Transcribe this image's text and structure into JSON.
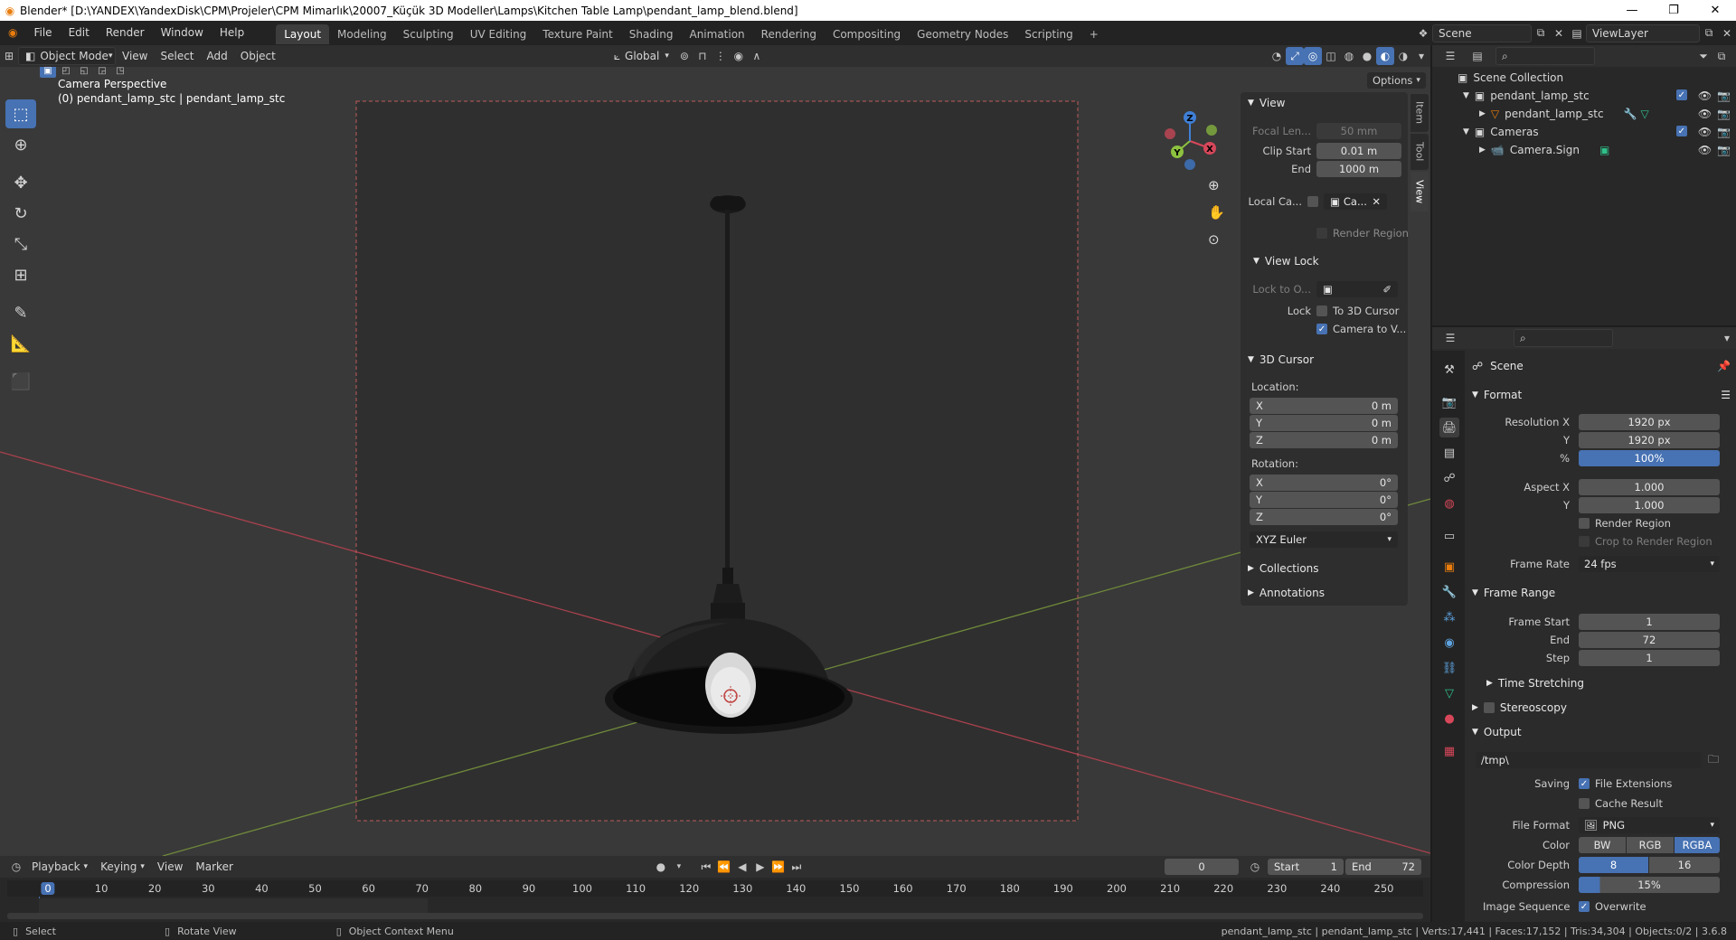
{
  "window": {
    "title": "Blender* [D:\\YANDEX\\YandexDisk\\CPM\\Projeler\\CPM Mimarlık\\20007_Küçük 3D Modeller\\Lamps\\Kitchen Table Lamp\\pendant_lamp_blend.blend]"
  },
  "menu": {
    "file": "File",
    "edit": "Edit",
    "render": "Render",
    "window": "Window",
    "help": "Help"
  },
  "workspaces": [
    "Layout",
    "Modeling",
    "Sculpting",
    "UV Editing",
    "Texture Paint",
    "Shading",
    "Animation",
    "Rendering",
    "Compositing",
    "Geometry Nodes",
    "Scripting"
  ],
  "scene_field": "Scene",
  "viewlayer_field": "ViewLayer",
  "viewport_header": {
    "mode": "Object Mode",
    "view": "View",
    "select": "Select",
    "add": "Add",
    "object": "Object",
    "orientation": "Global",
    "options": "Options"
  },
  "viewport": {
    "overlay_line1": "Camera Perspective",
    "overlay_line2": "(0) pendant_lamp_stc | pendant_lamp_stc",
    "gizmo": {
      "x": "X",
      "y": "Y",
      "z": "Z"
    }
  },
  "npanel": {
    "tabs": [
      "Item",
      "Tool",
      "View"
    ],
    "view_section": "View",
    "focal_label": "Focal Len...",
    "focal_value": "50 mm",
    "clip_start_label": "Clip Start",
    "clip_start_value": "0.01 m",
    "end_label": "End",
    "end_value": "1000 m",
    "local_cam_label": "Local Ca...",
    "local_cam_value": "Ca...",
    "render_region": "Render Region",
    "view_lock": "View Lock",
    "lock_to_label": "Lock to O...",
    "lock_label": "Lock",
    "to_3d_cursor": "To 3D Cursor",
    "camera_to_view": "Camera to V...",
    "cursor_section": "3D Cursor",
    "location_label": "Location:",
    "loc_x": "0 m",
    "loc_y": "0 m",
    "loc_z": "0 m",
    "rotation_label": "Rotation:",
    "rot_x": "0°",
    "rot_y": "0°",
    "rot_z": "0°",
    "axis_x": "X",
    "axis_y": "Y",
    "axis_z": "Z",
    "rotation_mode": "XYZ Euler",
    "collections": "Collections",
    "annotations": "Annotations"
  },
  "outliner": {
    "scene_collection": "Scene Collection",
    "items": [
      {
        "name": "pendant_lamp_stc"
      },
      {
        "name": "pendant_lamp_stc"
      },
      {
        "name": "Cameras"
      },
      {
        "name": "Camera.Sign"
      }
    ]
  },
  "properties": {
    "context": "Scene",
    "format": "Format",
    "res_x_label": "Resolution X",
    "res_x": "1920 px",
    "res_y_label": "Y",
    "res_y": "1920 px",
    "pct_label": "%",
    "pct": "100%",
    "aspect_x_label": "Aspect X",
    "aspect_x": "1.000",
    "aspect_y_label": "Y",
    "aspect_y": "1.000",
    "render_region": "Render Region",
    "crop": "Crop to Render Region",
    "frame_rate_label": "Frame Rate",
    "frame_rate": "24 fps",
    "frame_range": "Frame Range",
    "frame_start_label": "Frame Start",
    "frame_start": "1",
    "end_label": "End",
    "end": "72",
    "step_label": "Step",
    "step": "1",
    "time_stretching": "Time Stretching",
    "stereoscopy": "Stereoscopy",
    "output": "Output",
    "output_path": "/tmp\\",
    "saving_label": "Saving",
    "file_extensions": "File Extensions",
    "cache_result": "Cache Result",
    "file_format_label": "File Format",
    "file_format": "PNG",
    "color_label": "Color",
    "bw": "BW",
    "rgb": "RGB",
    "rgba": "RGBA",
    "depth_label": "Color Depth",
    "depth8": "8",
    "depth16": "16",
    "compression_label": "Compression",
    "compression": "15%",
    "image_seq_label": "Image Sequence",
    "overwrite": "Overwrite"
  },
  "timeline": {
    "playback": "Playback",
    "keying": "Keying",
    "view": "View",
    "marker": "Marker",
    "current_frame": "0",
    "start_label": "Start",
    "start": "1",
    "end_label": "End",
    "end": "72",
    "ticks": [
      "0",
      "10",
      "20",
      "30",
      "40",
      "50",
      "60",
      "70",
      "80",
      "90",
      "100",
      "110",
      "120",
      "130",
      "140",
      "150",
      "160",
      "170",
      "180",
      "190",
      "200",
      "210",
      "220",
      "230",
      "240",
      "250"
    ]
  },
  "status": {
    "select": "Select",
    "rotate": "Rotate View",
    "context_menu": "Object Context Menu",
    "stats": "pendant_lamp_stc | pendant_lamp_stc | Verts:17,441 | Faces:17,152 | Tris:34,304 | Objects:0/2 | 3.6.8"
  },
  "colors": {
    "accent_blue": "#4772b3",
    "x_axis": "#d7475a",
    "y_axis": "#8dc23f",
    "z_axis": "#3f7fd7",
    "blender_orange": "#e87d0d"
  }
}
